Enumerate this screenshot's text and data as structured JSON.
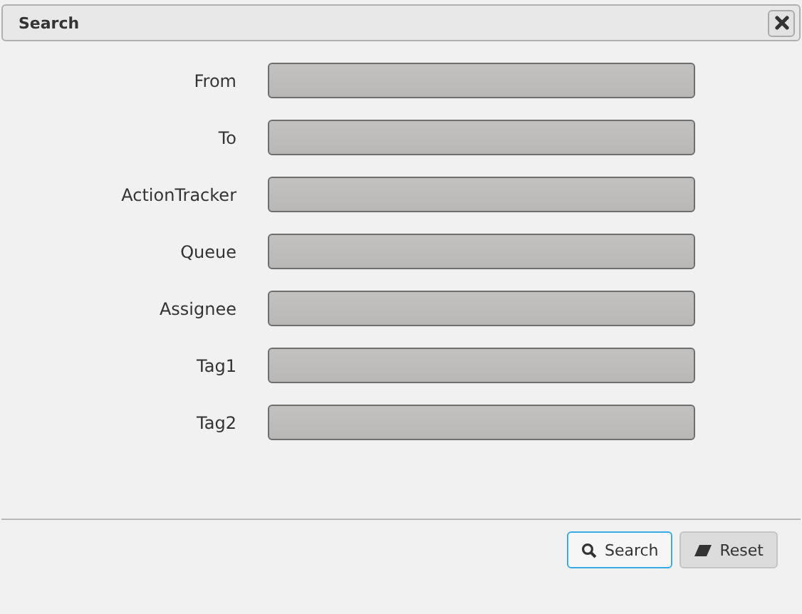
{
  "window": {
    "title": "Search"
  },
  "fields": [
    {
      "label": "From"
    },
    {
      "label": "To"
    },
    {
      "label": "ActionTracker"
    },
    {
      "label": "Queue"
    },
    {
      "label": "Assignee"
    },
    {
      "label": "Tag1"
    },
    {
      "label": "Tag2"
    }
  ],
  "buttons": [
    {
      "label": "Search",
      "kind": "search",
      "focused": true
    },
    {
      "label": "Reset",
      "kind": "reset",
      "focused": false
    }
  ]
}
